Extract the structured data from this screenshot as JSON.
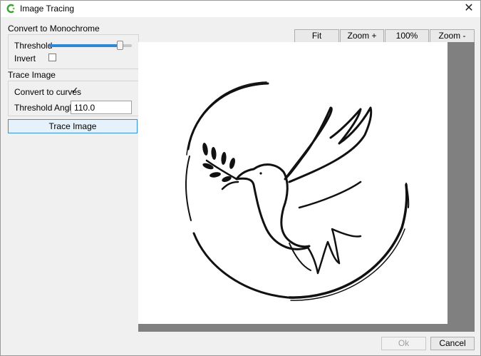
{
  "window": {
    "title": "Image Tracing",
    "close_symbol": "✕"
  },
  "monochrome": {
    "section_label": "Convert to Monochrome",
    "threshold_label": "Threshold",
    "threshold_level_fraction": 0.86,
    "invert_label": "Invert",
    "invert_checked": false
  },
  "trace": {
    "section_label": "Trace Image",
    "curves_label": "Convert to curves",
    "curves_checked": true,
    "angle_label": "Threshold Angle",
    "angle_value": "110.0",
    "trace_button": "Trace Image"
  },
  "zoom_toolbar": {
    "fit": "Fit",
    "zoom_in": "Zoom +",
    "actual": "100%",
    "zoom_out": "Zoom -"
  },
  "footer": {
    "ok": "Ok",
    "cancel": "Cancel"
  },
  "icons": {
    "app": "app-logo-icon",
    "close": "close-icon",
    "preview": "dove-with-olive-branch-image"
  },
  "colors": {
    "accent": "#2f86d9",
    "canvas_bg": "#808080",
    "window_bg": "#f0f0f0"
  }
}
